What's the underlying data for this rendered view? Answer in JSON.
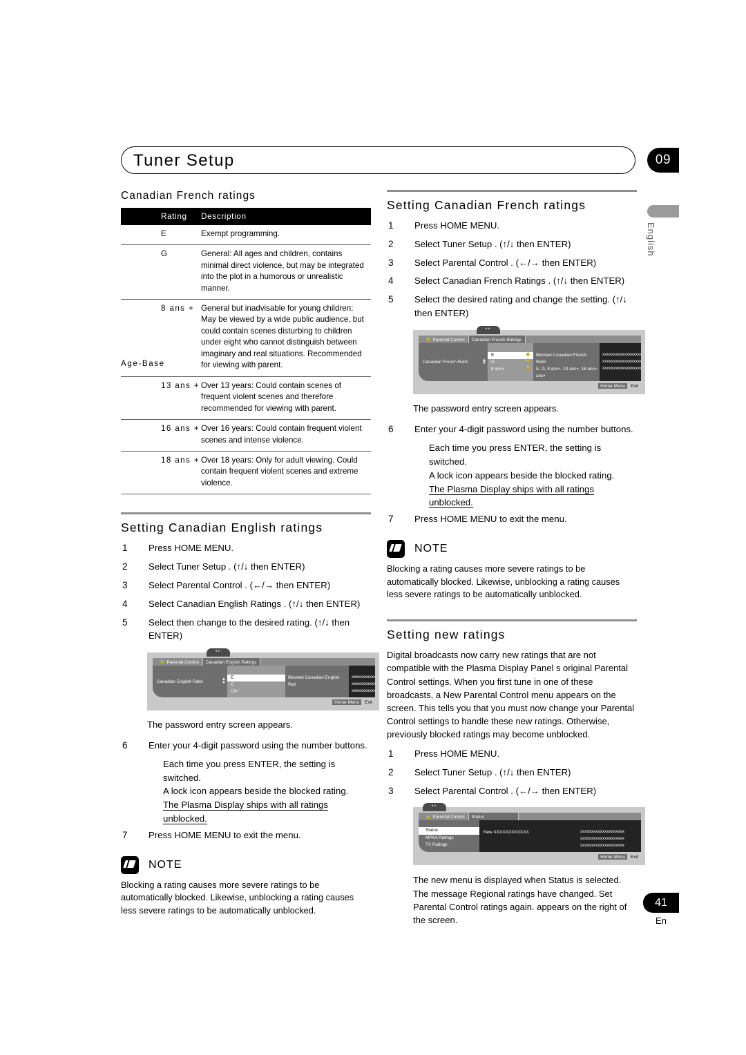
{
  "header": {
    "title": "Tuner Setup",
    "chapter": "09"
  },
  "sidebar": {
    "language": "English"
  },
  "footer": {
    "page_number": "41",
    "language_code": "En"
  },
  "left_column": {
    "table_heading": "Canadian French ratings",
    "table": {
      "columns": [
        "Rating",
        "Description"
      ],
      "axis_label": "Age-Base",
      "rows": [
        {
          "rating": "E",
          "description": "Exempt programming."
        },
        {
          "rating": "G",
          "description": "General: All ages and children, contains minimal direct violence, but may be integrated into the plot in a humorous or unrealistic manner."
        },
        {
          "rating": "8 ans +",
          "description": "General but inadvisable for young children: May be viewed by a wide public audience, but could contain scenes disturbing to children under eight who cannot distinguish between imaginary and real situations. Recommended for viewing with parent."
        },
        {
          "rating": "13 ans +",
          "description": "Over 13 years: Could contain scenes of frequent violent scenes and therefore recommended for viewing with parent."
        },
        {
          "rating": "16 ans +",
          "description": "Over 16 years: Could contain frequent violent scenes and intense violence."
        },
        {
          "rating": "18 ans +",
          "description": "Over 18 years: Only for adult viewing. Could contain frequent violent scenes and extreme violence."
        }
      ]
    },
    "section": {
      "heading": "Setting Canadian English ratings",
      "steps": [
        {
          "num": "1",
          "text": "Press HOME MENU."
        },
        {
          "num": "2",
          "text": "Select Tuner Setup . (↑/↓ then ENTER)"
        },
        {
          "num": "3",
          "text": "Select Parental Control . (←/→ then ENTER)"
        },
        {
          "num": "4",
          "text": "Select Canadian English Ratings . (↑/↓ then ENTER)"
        },
        {
          "num": "5",
          "text": "Select then change to the desired rating. (↑/↓ then ENTER)"
        }
      ],
      "caption": "The password entry screen appears.",
      "step6": {
        "num": "6",
        "text": "Enter your 4-digit password using the number buttons."
      },
      "step6_sub1": "Each time you press ENTER, the setting is switched.",
      "step6_sub2": "A lock icon appears beside the blocked rating.",
      "step6_sub3": "The Plasma Display ships with all ratings unblocked.",
      "step7": {
        "num": "7",
        "text": "Press HOME MENU to exit the menu."
      }
    },
    "osd": {
      "tab_parental": "Parental Control",
      "tab_active": "Canadian English Ratings",
      "left_label": "Canadian English Ratin",
      "list": [
        {
          "label": "E",
          "lock": ""
        },
        {
          "label": "C",
          "lock": ""
        },
        {
          "label": "C8+",
          "lock": ""
        }
      ],
      "mid_label": "Blocked Canadian English Rati",
      "mid_value": "",
      "right_lines": [
        "xxxxxxxxxxxxxxxxxxxxxx",
        "xxxxxxxxxxxxxxxxxxxxxx",
        "xxxxxxxxxxxxxxxxxxxxxx"
      ],
      "btn_home": "Home Menu",
      "btn_exit": "Exit",
      "knob": "◂▸"
    },
    "note": {
      "title": "NOTE",
      "body": "Blocking a rating causes more severe ratings to be automatically blocked. Likewise, unblocking a rating causes less severe ratings to be automatically unblocked."
    }
  },
  "right_column": {
    "section_french": {
      "heading": "Setting Canadian French ratings",
      "steps": [
        {
          "num": "1",
          "text": "Press HOME MENU."
        },
        {
          "num": "2",
          "text": "Select Tuner Setup . (↑/↓ then ENTER)"
        },
        {
          "num": "3",
          "text": "Select Parental Control . (←/→ then ENTER)"
        },
        {
          "num": "4",
          "text": "Select Canadian French Ratings . (↑/↓ then ENTER)"
        },
        {
          "num": "5",
          "text": "Select the desired rating and change the setting. (↑/↓ then ENTER)"
        }
      ],
      "caption": "The password entry screen appears.",
      "step6": {
        "num": "6",
        "text": "Enter your 4-digit password using the number buttons."
      },
      "step6_sub1": "Each time you press ENTER, the setting is switched.",
      "step6_sub2": "A lock icon appears beside the blocked rating.",
      "step6_sub3": "The Plasma Display ships with all ratings unblocked.",
      "step7": {
        "num": "7",
        "text": "Press HOME MENU to exit the menu."
      }
    },
    "osd_french": {
      "tab_parental": "Parental Control",
      "tab_active": "Canadian French Ratings",
      "left_label": "Canadian French Ratin",
      "list": [
        {
          "label": "E",
          "lock": "🔒"
        },
        {
          "label": "G",
          "lock": "🔒"
        },
        {
          "label": "8 ans+",
          "lock": "🔒"
        }
      ],
      "mid_label": "Blocked Canadian French Ratin",
      "mid_value": "E, G, 8 ans+, 13 ans+, 16 ans+ ans+",
      "right_lines": [
        "xxxxxxxxxxxxxxxxxxxxxx",
        "xxxxxxxxxxxxxxxxxxxxxx",
        "xxxxxxxxxxxxxxxxxxxxxx"
      ],
      "btn_home": "Home Menu",
      "btn_exit": "Exit",
      "knob": "◂▸"
    },
    "note": {
      "title": "NOTE",
      "body": "Blocking a rating causes more severe ratings to be automatically blocked. Likewise, unblocking a rating causes less severe ratings to be automatically unblocked."
    },
    "section_new": {
      "heading": "Setting new ratings",
      "intro": "Digital broadcasts now carry new ratings that are not compatible with the Plasma Display Panel s original Parental Control settings. When you first tune in one of these broadcasts, a New Parental Control menu appears on the screen. This tells you that you must now change your Parental Control settings to handle these new ratings. Otherwise, previously blocked ratings may become unblocked.",
      "steps": [
        {
          "num": "1",
          "text": "Press HOME MENU."
        },
        {
          "num": "2",
          "text": "Select Tuner Setup . (↑/↓ then ENTER)"
        },
        {
          "num": "3",
          "text": "Select Parental Control . (←/→ then ENTER)"
        }
      ],
      "closing": "The new menu is displayed when Status is selected. The message Regional ratings have changed. Set Parental Control ratings again. appears on the right of the screen."
    },
    "osd_status": {
      "tab_parental": "Parental Control",
      "tab_active": "Status",
      "list": [
        {
          "label": "Status"
        },
        {
          "label": "MPAA Ratings"
        },
        {
          "label": "TV Ratings"
        }
      ],
      "mid_value": "New XXXXXXXXXXXX",
      "right_lines": [
        "xxxxxxxxxxxxxxxxxxxx",
        "xxxxxxxxxxxxxxxxxxxx",
        "xxxxxxxxxxxxxxxxxxxx"
      ],
      "btn_home": "Home Menu",
      "btn_exit": "Exit",
      "knob": "◂▸"
    }
  }
}
